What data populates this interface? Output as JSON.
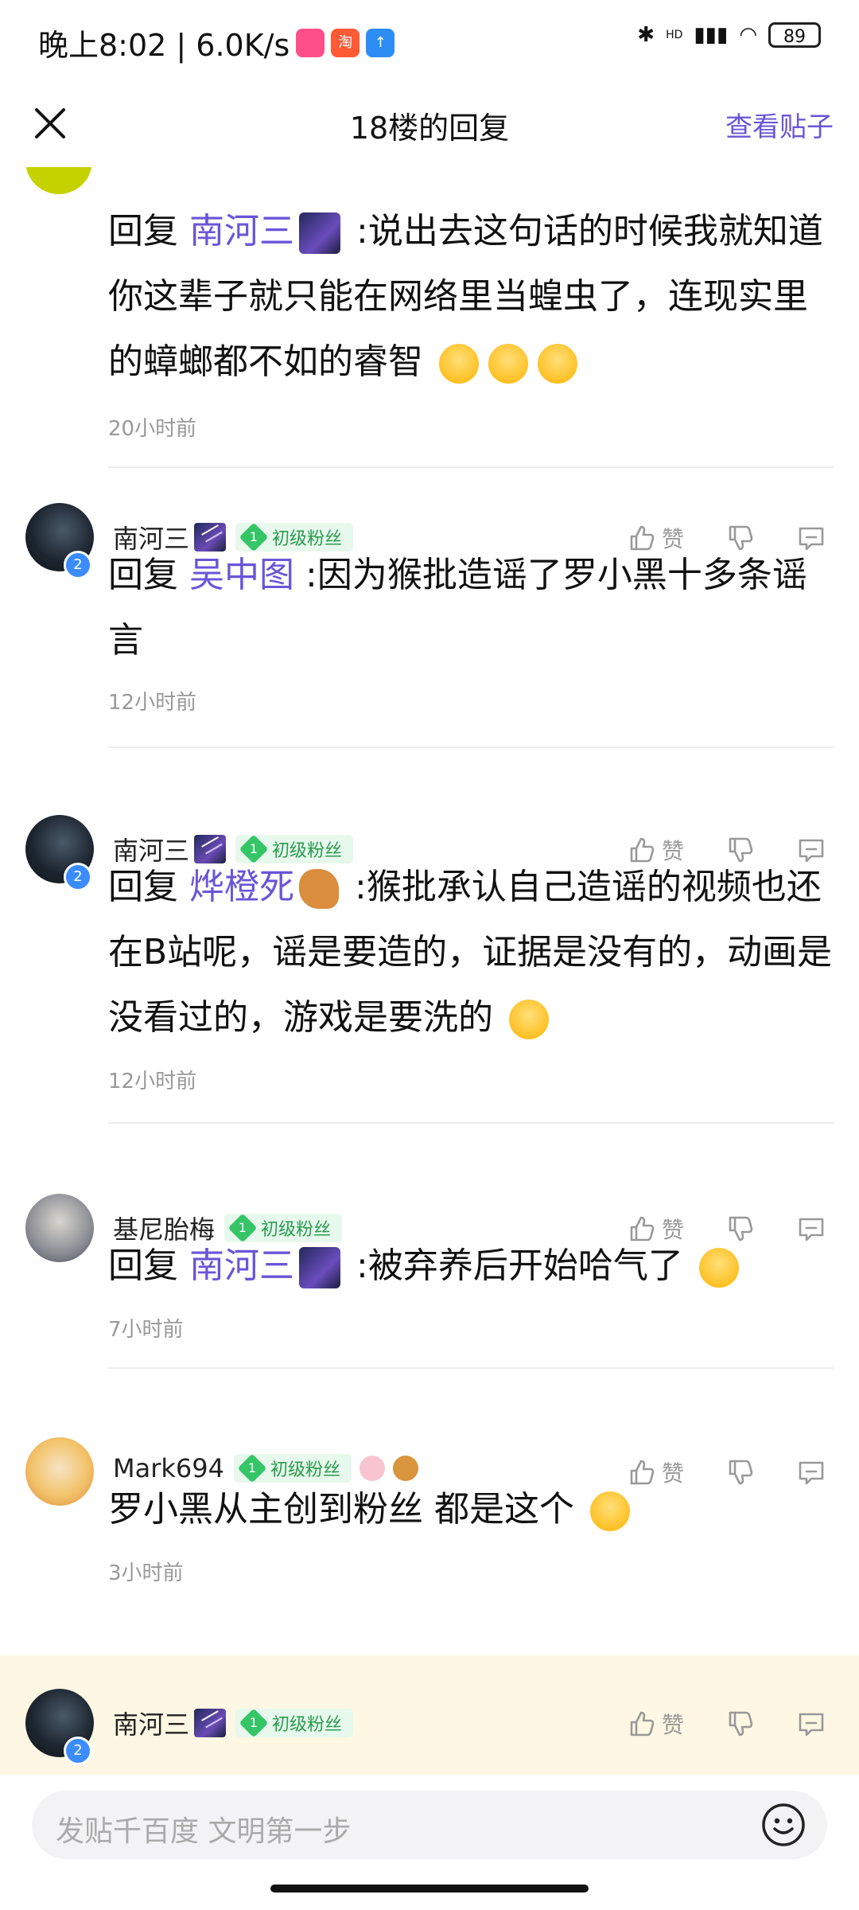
{
  "status_bar": {
    "time_speed": "晚上8:02 | 6.0K/s",
    "battery": "89",
    "hd": "HD"
  },
  "header": {
    "title": "18楼的回复",
    "view_post": "查看贴子"
  },
  "replies": [
    {
      "prefix": "回复",
      "mention": "南河三",
      "text": ":说出去这句话的时候我就知道你这辈子就只能在网络里当蝗虫了，连现实里的蟑螂都不如的睿智",
      "time": "20小时前"
    },
    {
      "user": "南河三",
      "badge": "初级粉丝",
      "badge_level": "1",
      "avatar_level": "2",
      "like": "赞",
      "prefix": "回复",
      "mention": "吴中图",
      "text": ":因为猴批造谣了罗小黑十多条谣言",
      "time": "12小时前"
    },
    {
      "user": "南河三",
      "badge": "初级粉丝",
      "badge_level": "1",
      "avatar_level": "2",
      "like": "赞",
      "prefix": "回复",
      "mention": "烨橙死",
      "text": ":猴批承认自己造谣的视频也还在B站呢，谣是要造的，证据是没有的，动画是没看过的，游戏是要洗的",
      "time": "12小时前"
    },
    {
      "user": "基尼胎梅",
      "badge": "初级粉丝",
      "badge_level": "1",
      "like": "赞",
      "prefix": "回复",
      "mention": "南河三",
      "text": ":被弃养后开始哈气了",
      "time": "7小时前"
    },
    {
      "user": "Mark694",
      "badge": "初级粉丝",
      "badge_level": "1",
      "like": "赞",
      "text": "罗小黑从主创到粉丝 都是这个",
      "time": "3小时前"
    },
    {
      "user": "南河三",
      "badge": "初级粉丝",
      "badge_level": "1",
      "avatar_level": "2",
      "like": "赞"
    }
  ],
  "input": {
    "placeholder": "发贴千百度 文明第一步"
  },
  "colors": {
    "accent": "#6a55d8",
    "badge_green": "#35c567",
    "highlight": "#fdf7e3"
  }
}
